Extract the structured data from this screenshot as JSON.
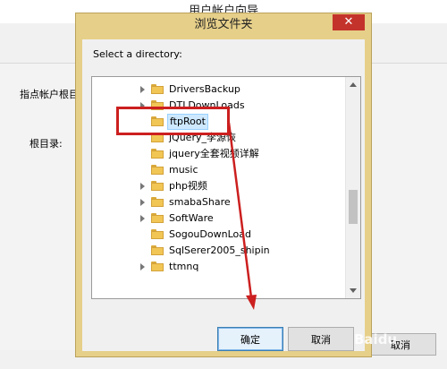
{
  "background_window": {
    "title": "用户帐户向导",
    "root_label": "指点帐户根目",
    "dir_label": "根目录:",
    "cancel_label": "取消"
  },
  "dialog": {
    "title": "浏览文件夹",
    "close_glyph": "✕",
    "prompt": "Select a directory:",
    "ok_label": "确定",
    "cancel_label": "取消",
    "selected_item": "ftpRoot"
  },
  "tree_items": [
    {
      "label": "DriversBackup",
      "has_children": true
    },
    {
      "label": "DTLDownLoads",
      "has_children": true
    },
    {
      "label": "ftpRoot",
      "has_children": false,
      "selected": true
    },
    {
      "label": "jQuery_李源恢",
      "has_children": false
    },
    {
      "label": "jquery全套视频详解",
      "has_children": false
    },
    {
      "label": "music",
      "has_children": false
    },
    {
      "label": "php视频",
      "has_children": true
    },
    {
      "label": "smabaShare",
      "has_children": true
    },
    {
      "label": "SoftWare",
      "has_children": true
    },
    {
      "label": "SogouDownLoad",
      "has_children": false
    },
    {
      "label": "SqlSerer2005_shipin",
      "has_children": false
    },
    {
      "label": "ttmnq",
      "has_children": true
    }
  ],
  "colors": {
    "dialog_frame": "#e6cf89",
    "close_button": "#c4332b",
    "annotation_red": "#cc1f1f",
    "selection": "#cde8ff",
    "folder": "#f2c654"
  },
  "watermark": "Baidu"
}
